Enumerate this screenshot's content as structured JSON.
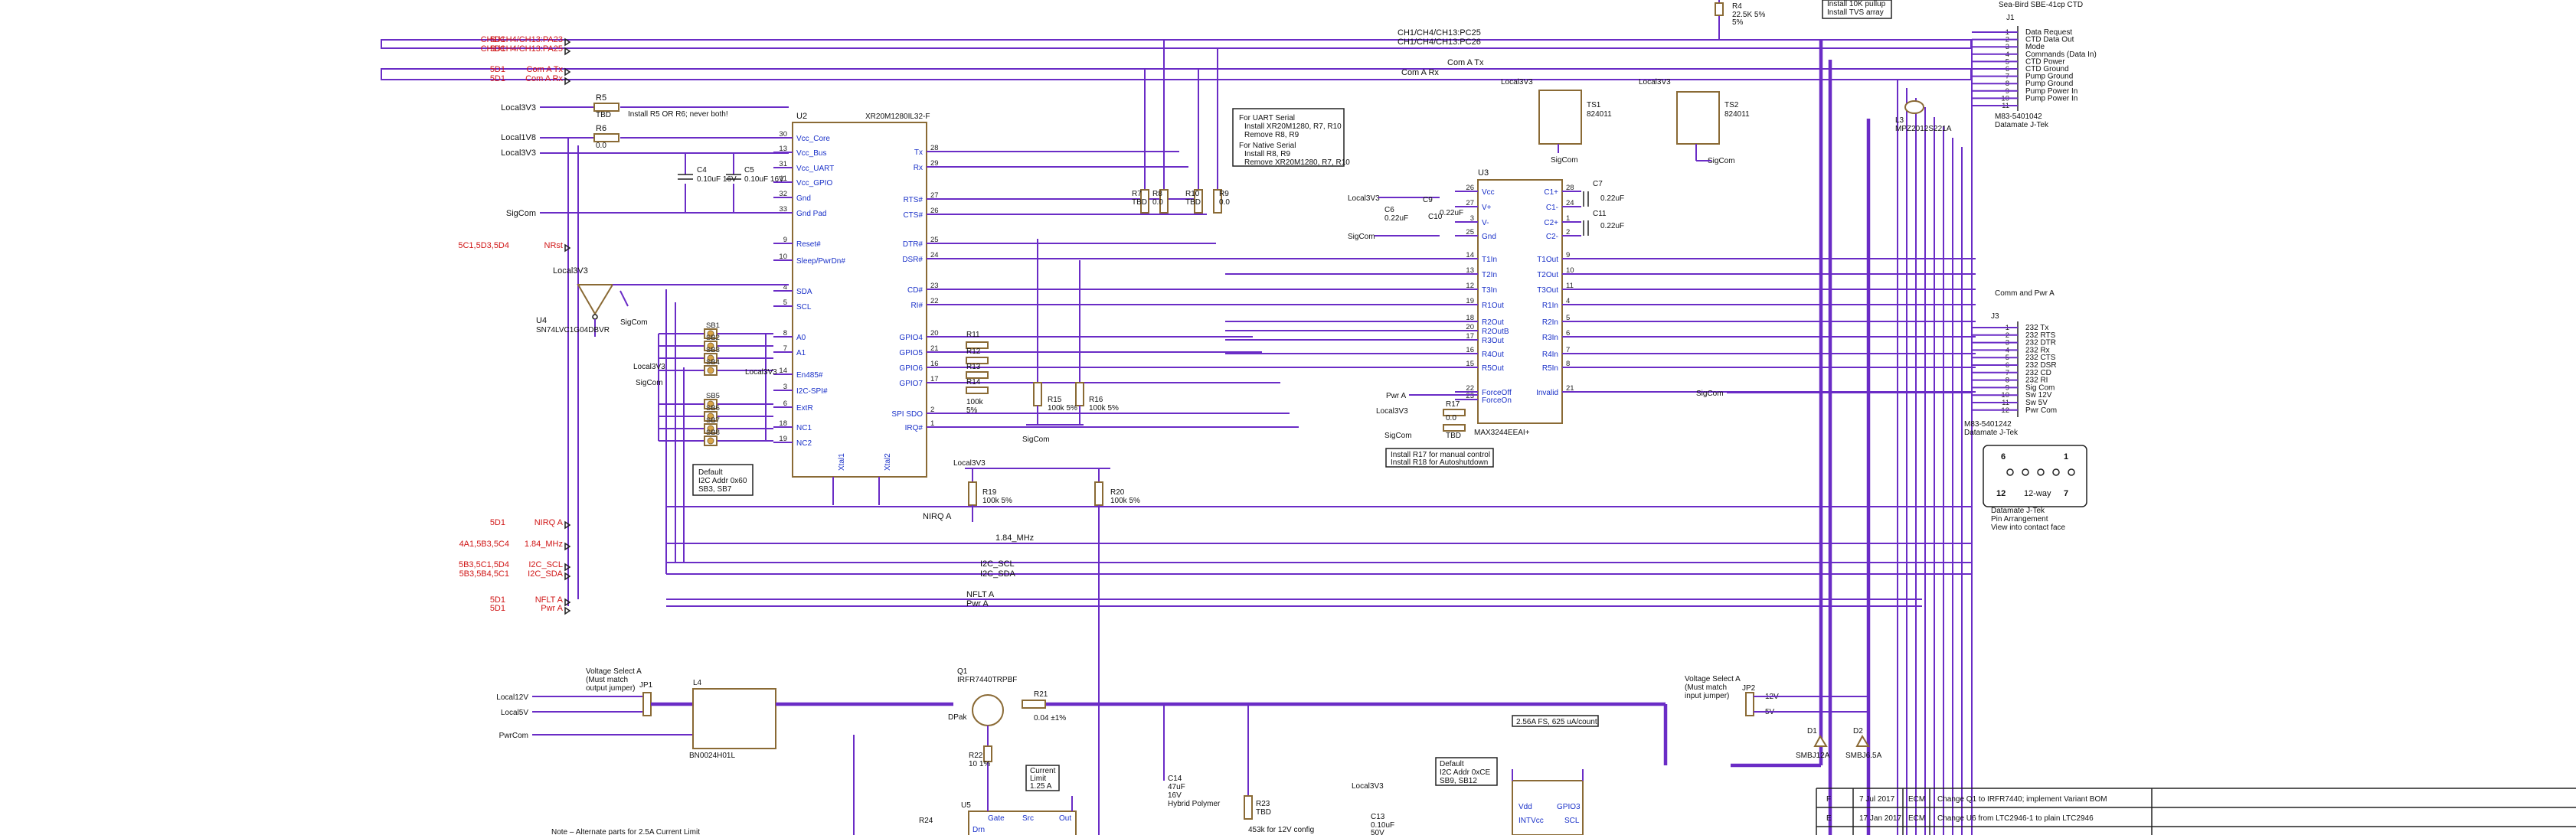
{
  "nets": {
    "left_refs": [
      "5D1",
      "5D1",
      "5D1",
      "5D1",
      "5C1,5D3,5D4",
      "5D1",
      "4A1,5B3,5C4",
      "5B3,5C1,5D4",
      "5B3,5B4,5C1",
      "5D1",
      "5D1"
    ],
    "left_names": [
      "CH1/CH4/CH13:PA23",
      "CH1/CH4/CH13:PA25",
      "Com A Tx",
      "Com A Rx",
      "NRst",
      "NIRQ A",
      "1.84_MHz",
      "I2C_SCL",
      "I2C_SDA",
      "NFLT A",
      "Pwr A"
    ],
    "top_bus": [
      "CH1/CH4/CH13:PC25",
      "CH1/CH4/CH13:PC26",
      "Com A Tx",
      "Com A Rx"
    ],
    "mid_bus": [
      "NIRQ A",
      "1.84_MHz",
      "I2C_SCL",
      "I2C_SDA",
      "NFLT A",
      "Pwr A"
    ],
    "rails": [
      "Local3V3",
      "Local1V8",
      "Local3V3",
      "SigCom",
      "Local12V",
      "Local5V",
      "PwrCom"
    ]
  },
  "u2": {
    "ref": "U2",
    "part": "XR20M1280IL32-F",
    "pins_left": [
      "Vcc_Core",
      "Vcc_Bus",
      "Vcc_UART",
      "Vcc_GPIO",
      "Gnd",
      "Gnd Pad",
      "Reset#",
      "Sleep/PwrDn#",
      "SDA",
      "SCL",
      "A0",
      "A1",
      "En485#",
      "I2C-SPI#",
      "ExtR",
      "NC1",
      "NC2"
    ],
    "pins_left_num": [
      "30",
      "13",
      "31",
      "11",
      "32",
      "33",
      "9",
      "10",
      "4",
      "5",
      "8",
      "7",
      "14",
      "3",
      "6",
      "18",
      "19"
    ],
    "pins_right": [
      "Tx",
      "Rx",
      "RTS#",
      "CTS#",
      "DTR#",
      "DSR#",
      "CD#",
      "RI#",
      "GPIO4",
      "GPIO5",
      "GPIO6",
      "GPIO7",
      "SPI SDO",
      "IRQ#"
    ],
    "pins_right_num": [
      "28",
      "29",
      "27",
      "26",
      "25",
      "24",
      "23",
      "22",
      "20",
      "21",
      "16",
      "17",
      "2",
      "1"
    ],
    "pins_bottom": [
      "Xtal1",
      "Xtal2"
    ]
  },
  "u3": {
    "ref": "U3",
    "part": "MAX3244EEAI+",
    "pins_left": [
      "Vcc",
      "V+",
      "V-",
      "Gnd",
      "T1In",
      "T2In",
      "T3In",
      "R1Out",
      "R2Out",
      "R2OutB",
      "R3Out",
      "R4Out",
      "R5Out",
      "ForceOff",
      "ForceOn"
    ],
    "pins_left_num": [
      "26",
      "27",
      "3",
      "25",
      "14",
      "13",
      "12",
      "19",
      "18",
      "20",
      "17",
      "16",
      "15",
      "22",
      "23"
    ],
    "pins_right": [
      "C1+",
      "C1-",
      "C2+",
      "C2-",
      "T1Out",
      "T2Out",
      "T3Out",
      "R1In",
      "R2In",
      "R3In",
      "R4In",
      "R5In",
      "Invalid"
    ],
    "pins_right_num": [
      "28",
      "24",
      "1",
      "2",
      "9",
      "10",
      "11",
      "4",
      "5",
      "6",
      "7",
      "8",
      "21"
    ]
  },
  "u4": {
    "ref": "U4",
    "part": "SN74LVC1G04DBVR",
    "supply": "Local3V3",
    "gnd": "SigCom"
  },
  "solder_bridges": [
    "SB1",
    "SB2",
    "SB3",
    "SB4",
    "SB5",
    "SB6",
    "SB7",
    "SB8"
  ],
  "notes": {
    "r5r6": "Install R5 OR R6; never both!",
    "uart": [
      "For UART Serial",
      "Install XR20M1280, R7, R10",
      "Remove R8, R9"
    ],
    "native": [
      "For Native Serial",
      "Install R8, R9",
      "Remove XR20M1280, R7, R10"
    ],
    "i2c_default": [
      "Default",
      "I2C Addr 0x60",
      "SB3, SB7"
    ],
    "r17r18": [
      "Install R17 for manual control",
      "Install R18 for Autoshutdown"
    ],
    "current_limit": [
      "Current",
      "Limit",
      "1.25 A"
    ],
    "alt_parts": "Note – Alternate parts for 2.5A Current Limit",
    "fs": "2.56A FS, 625 uA/count",
    "i2c_default2": [
      "Default",
      "I2C Addr 0xCE",
      "SB9, SB12"
    ],
    "tvs_top": [
      "Install 10K pullup",
      "Install TVS array"
    ]
  },
  "resistors": {
    "R5": "TBD",
    "R6": "0.0",
    "R7": "TBD",
    "R8": "0.0",
    "R9": "0.0",
    "R10": "TBD",
    "R11": "",
    "R12": "",
    "R13": "",
    "R14": "",
    "R15": "100k 5%",
    "R16": "100k 5%",
    "R17": "0.0",
    "R18": "TBD",
    "R19": "100k 5%",
    "R20": "100k 5%",
    "R21": "0.04 ±1%",
    "R22": "10 1%",
    "R23": "TBD",
    "R24": "",
    "R4": "22.5K 5%"
  },
  "caps": {
    "C4": "0.10uF 16V",
    "C5": "0.10uF 16V",
    "C6": "0.22uF",
    "C9": "0.22uF",
    "C10": "0.22uF",
    "C7": "0.22uF",
    "C11": "0.22uF",
    "C13": "0.10uF 50V",
    "C14": "47uF 16V Hybrid Polymer"
  },
  "j1": {
    "ref": "J1",
    "title": "Sea-Bird SBE-41cp CTD",
    "nums": [
      "1",
      "2",
      "3",
      "4",
      "5",
      "6",
      "7",
      "8",
      "9",
      "10",
      "11"
    ],
    "pins": [
      "Data Request",
      "CTD Data Out",
      "Mode",
      "Commands (Data In)",
      "CTD Power",
      "CTD Ground",
      "Pump Ground",
      "Pump Ground",
      "Pump Power In",
      "Pump Power In"
    ],
    "part": [
      "M83-5401042",
      "Datamate J-Tek"
    ]
  },
  "j2": {
    "title": "Comm and Pwr A",
    "ref": "J3",
    "nums": [
      "1",
      "2",
      "3",
      "4",
      "5",
      "6",
      "7",
      "8",
      "9",
      "10",
      "11",
      "12"
    ],
    "pins": [
      "232 Tx",
      "232 RTS",
      "232 DTR",
      "232 Rx",
      "232 CTS",
      "232 DSR",
      "232 CD",
      "232 RI",
      "Sig Com",
      "Sw 12V",
      "Sw 5V",
      "Pwr Com"
    ],
    "part": [
      "M83-5401242",
      "Datamate J-Tek"
    ],
    "face": {
      "tl": "6",
      "tr": "1",
      "bl": "12",
      "mid": "12-way",
      "br": "7"
    },
    "face_caption": [
      "Datamate J-Tek",
      "Pin Arrangement",
      "View into contact face"
    ]
  },
  "misc": {
    "ts1": "TS1",
    "ts2": "TS2",
    "ts_part": "824011",
    "l3": "L3",
    "l3_part": "MPZ2012S221A",
    "jp1": "JP1",
    "jp2": "JP2",
    "vsel_a": [
      "Voltage Select A",
      "(Must match",
      "output jumper)"
    ],
    "vsel_b": [
      "Voltage Select A",
      "(Must match",
      "input jumper)"
    ],
    "l4": "L4",
    "l4_part": "BN0024H01L",
    "q1": "Q1",
    "q1_part": "IRFR7440TRPBF",
    "dpak": "DPak",
    "d1": "D1",
    "d2": "D2",
    "d1_part": "SMBJ12A",
    "d2_part": "SMBJ6.5A",
    "r23_note": "453k for 12V config",
    "v12": "12V",
    "v5": "5V",
    "u5": "U5",
    "u5_pins": [
      "Gate",
      "Src",
      "Out",
      "Drn"
    ],
    "u6_pins": [
      "Vdd",
      "INTVcc",
      "SCL",
      "GPIO3"
    ]
  },
  "revisions": [
    {
      "rev": "F",
      "date": "7 Jul 2017",
      "by": "ECM",
      "desc": "Change Q1 to IRFR7440; implement Variant BOM"
    },
    {
      "rev": "E",
      "date": "17 Jan 2017",
      "by": "ECM",
      "desc": "Change U6 from LTC2946-1 to plain LTC2946"
    }
  ]
}
